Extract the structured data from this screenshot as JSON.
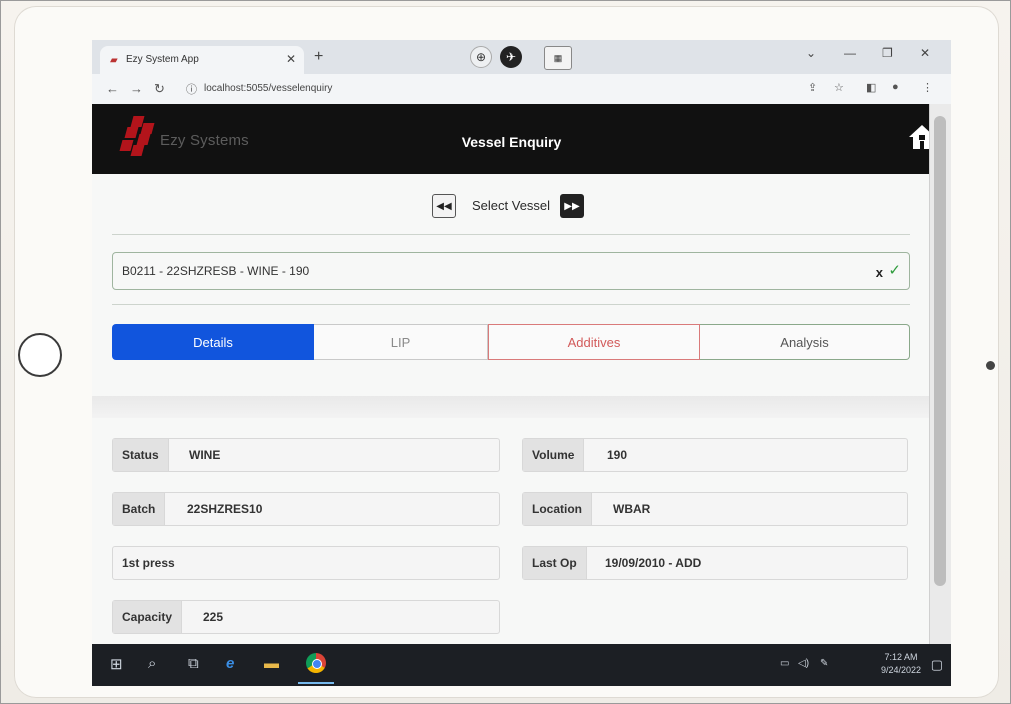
{
  "browser": {
    "tab_title": "Ezy System App",
    "url": "localhost:5055/vesselenquiry"
  },
  "app": {
    "logo_text": "Ezy Systems",
    "title": "Vessel Enquiry",
    "select_vessel_label": "Select Vessel",
    "vessel_value": "B0211 - 22SHZRESB - WINE - 190",
    "clear_label": "x",
    "tabs": [
      {
        "label": "Details",
        "active": true
      },
      {
        "label": "LIP"
      },
      {
        "label": "Additives"
      },
      {
        "label": "Analysis"
      }
    ],
    "fields_left": [
      {
        "label": "Status",
        "value": "WINE"
      },
      {
        "label": "Batch",
        "value": "22SHZRES10"
      },
      {
        "label": "1st press",
        "value": ""
      },
      {
        "label": "Capacity",
        "value": "225"
      }
    ],
    "fields_right": [
      {
        "label": "Volume",
        "value": "190"
      },
      {
        "label": "Location",
        "value": "WBAR"
      },
      {
        "label": "Last Op",
        "value": "19/09/2010 - ADD"
      }
    ]
  },
  "taskbar": {
    "time": "7:12 AM",
    "date": "9/24/2022"
  },
  "colors": {
    "active_tab": "#1155dd",
    "additives_tab": "#d25a5a",
    "check": "#2e9c3c"
  }
}
